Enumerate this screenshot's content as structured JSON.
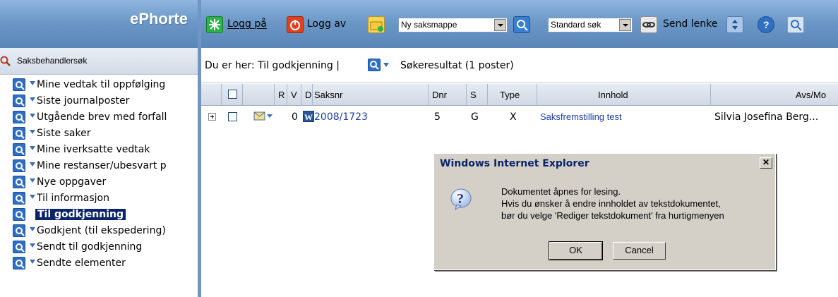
{
  "app": {
    "title": "ePhorte"
  },
  "left": {
    "header": "Saksbehandlersøk",
    "items": [
      {
        "label": "Mine vedtak til oppfølging",
        "selected": false
      },
      {
        "label": "Siste journalposter",
        "selected": false
      },
      {
        "label": "Utgående brev med forfall",
        "selected": false
      },
      {
        "label": "Siste saker",
        "selected": false
      },
      {
        "label": "Mine iverksatte vedtak",
        "selected": false
      },
      {
        "label": "Mine restanser/ubesvart p",
        "selected": false
      },
      {
        "label": "Nye oppgaver",
        "selected": false
      },
      {
        "label": "Til informasjon",
        "selected": false
      },
      {
        "label": "Til godkjenning",
        "selected": true
      },
      {
        "label": "Godkjent (til ekspedering)",
        "selected": false
      },
      {
        "label": "Sendt til godkjenning",
        "selected": false
      },
      {
        "label": "Sendte elementer",
        "selected": false
      }
    ]
  },
  "toolbar": {
    "login_label": "Logg på",
    "logout_label": "Logg av",
    "new_folder_select": "Ny saksmappe",
    "search_select": "Standard søk",
    "send_link_label": "Send lenke"
  },
  "breadcrumb": {
    "prefix": "Du er her: Til godkjenning |",
    "result": "Søkeresultat (1 poster)"
  },
  "table": {
    "headers": {
      "r": "R",
      "v": "V",
      "d": "D",
      "saksnr": "Saksnr",
      "dnr": "Dnr",
      "s": "S",
      "type": "Type",
      "innhold": "Innhold",
      "avs": "Avs/Mo"
    },
    "rows": [
      {
        "v": "0",
        "saksnr": "2008/1723",
        "dnr": "5",
        "s": "G",
        "type": "X",
        "innhold": "Saksfremstilling test",
        "avs": "Silvia Josefina Berg..."
      }
    ]
  },
  "dialog": {
    "title": "Windows Internet Explorer",
    "message_line1": "Dokumentet åpnes for lesing.",
    "message_line2": "Hvis du ønsker å endre innholdet av tekstdokumentet,",
    "message_line3": "bør du velge 'Rediger tekstdokument' fra hurtigmenyen",
    "ok_label": "OK",
    "cancel_label": "Cancel"
  }
}
